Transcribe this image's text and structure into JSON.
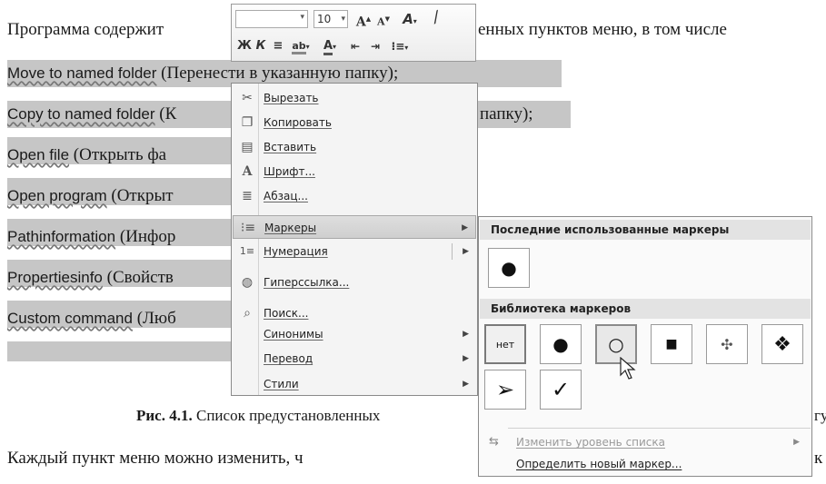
{
  "document": {
    "line_top_left": "Программа содержит",
    "line_top_right": "енных пунктов меню, в том числе",
    "items": [
      {
        "en": "Move to named folder",
        "ru": " (Перенести в указанную папку);"
      },
      {
        "en": "Copy to named folder",
        "ru": " (К",
        "ru_tail": "папку);"
      },
      {
        "en": "Open file",
        "ru": " (Открыть фа"
      },
      {
        "en": "Open program",
        "ru": " (Открыт"
      },
      {
        "en": "Pathinformation",
        "ru": " (Инфор"
      },
      {
        "en": "Propertiesinfo",
        "ru": " (Свойств"
      },
      {
        "en": "Custom command",
        "ru": " (Люб"
      }
    ],
    "caption_bold": "Рис. 4.1.",
    "caption_text": " Список предустановленных",
    "caption_tail": "гу",
    "bottom_left": "Каждый   пункт   меню   можно   изменить,   ч",
    "bottom_right": "к"
  },
  "minibar": {
    "font_size": "10",
    "grow_font": "A",
    "shrink_font": "A",
    "bold": "Ж",
    "italic": "К",
    "font_color_letter": "A"
  },
  "context_menu": {
    "items": [
      {
        "label": "Вырезать",
        "icon": "scissors-icon",
        "glyph": "✂"
      },
      {
        "label": "Копировать",
        "icon": "copy-icon",
        "glyph": "⎘"
      },
      {
        "label": "Вставить",
        "icon": "paste-icon",
        "glyph": "📋"
      },
      {
        "label": "Шрифт...",
        "icon": "font-icon",
        "glyph": "A"
      },
      {
        "label": "Абзац...",
        "icon": "paragraph-icon",
        "glyph": "≣"
      },
      {
        "label": "Маркеры",
        "icon": "bullets-icon",
        "glyph": "⁝≡",
        "submenu": true
      },
      {
        "label": "Нумерация",
        "icon": "numbering-icon",
        "glyph": "⒈≡",
        "submenu": true
      },
      {
        "label": "Гиперссылка...",
        "icon": "hyperlink-icon",
        "glyph": "🌐"
      },
      {
        "label": "Поиск...",
        "icon": "search-icon",
        "glyph": "🔍"
      },
      {
        "label": "Синонимы",
        "icon": "",
        "glyph": "",
        "submenu": true
      },
      {
        "label": "Перевод",
        "icon": "",
        "glyph": "",
        "submenu": true
      },
      {
        "label": "Стили",
        "icon": "",
        "glyph": "",
        "submenu": true
      }
    ]
  },
  "bullets_gallery": {
    "recent_header": "Последние использованные маркеры",
    "library_header": "Библиотека маркеров",
    "none_label": "нет",
    "change_level": "Изменить уровень списка",
    "define_new": "Определить новый маркер..."
  }
}
